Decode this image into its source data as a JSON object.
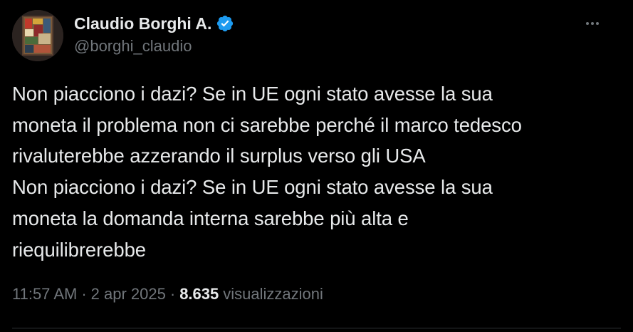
{
  "colors": {
    "background": "#000000",
    "primary_text": "#e7e9ea",
    "secondary_text": "#71767b",
    "verified_badge": "#1d9bf0",
    "divider": "#2f3336"
  },
  "author": {
    "display_name": "Claudio Borghi A.",
    "handle": "@borghi_claudio",
    "verified": true,
    "avatar_icon": "avatar-painting-icon",
    "verified_icon": "verified-badge-icon"
  },
  "menu": {
    "more_icon": "more-options-icon"
  },
  "tweet": {
    "lines": [
      "Non piacciono i dazi? Se in UE ogni stato avesse la sua",
      "moneta il problema non ci sarebbe perché il marco tedesco",
      "rivaluterebbe azzerando il surplus verso gli USA",
      "Non piacciono i dazi? Se in UE ogni stato avesse la sua",
      "moneta la domanda interna sarebbe più alta e",
      "riequilibrerebbe"
    ]
  },
  "meta": {
    "time": "11:57 AM",
    "separator": "·",
    "date": "2 apr 2025",
    "views_count": "8.635",
    "views_label": "visualizzazioni"
  }
}
